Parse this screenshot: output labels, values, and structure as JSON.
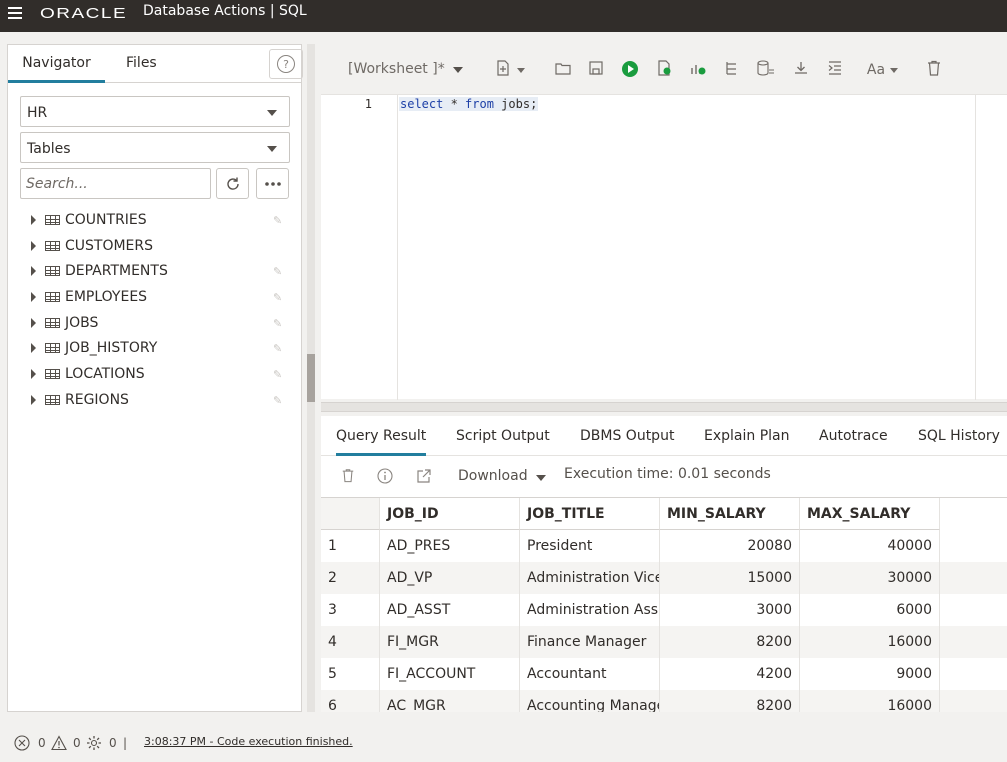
{
  "header": {
    "brand": "ORACLE",
    "app_title": "Database Actions |  SQL"
  },
  "navigator": {
    "tabs": [
      {
        "label": "Navigator"
      },
      {
        "label": "Files"
      }
    ],
    "help_label": "?",
    "schema": "HR",
    "object_type": "Tables",
    "search_placeholder": "Search...",
    "tables": [
      {
        "label": "COUNTRIES"
      },
      {
        "label": "CUSTOMERS"
      },
      {
        "label": "DEPARTMENTS"
      },
      {
        "label": "EMPLOYEES"
      },
      {
        "label": "JOBS"
      },
      {
        "label": "JOB_HISTORY"
      },
      {
        "label": "LOCATIONS"
      },
      {
        "label": "REGIONS"
      }
    ]
  },
  "worksheet": {
    "name": "[Worksheet ]*",
    "line_number": "1",
    "code": {
      "kw1": "select",
      "mid": " * ",
      "kw2": "from",
      "rest": " jobs;"
    }
  },
  "results": {
    "tabs": [
      {
        "label": "Query Result"
      },
      {
        "label": "Script Output"
      },
      {
        "label": "DBMS Output"
      },
      {
        "label": "Explain Plan"
      },
      {
        "label": "Autotrace"
      },
      {
        "label": "SQL History"
      }
    ],
    "download_label": "Download",
    "execution_time": "Execution time: 0.01 seconds",
    "columns": [
      "JOB_ID",
      "JOB_TITLE",
      "MIN_SALARY",
      "MAX_SALARY"
    ],
    "rows": [
      [
        "1",
        "AD_PRES",
        "President",
        "20080",
        "40000"
      ],
      [
        "2",
        "AD_VP",
        "Administration Vice",
        "15000",
        "30000"
      ],
      [
        "3",
        "AD_ASST",
        "Administration Ass",
        "3000",
        "6000"
      ],
      [
        "4",
        "FI_MGR",
        "Finance Manager",
        "8200",
        "16000"
      ],
      [
        "5",
        "FI_ACCOUNT",
        "Accountant",
        "4200",
        "9000"
      ],
      [
        "6",
        "AC_MGR",
        "Accounting Manage",
        "8200",
        "16000"
      ]
    ]
  },
  "status": {
    "errors": "0",
    "warnings": "0",
    "tasks": "0",
    "separator": "|",
    "message": "3:08:37 PM - Code execution finished."
  }
}
